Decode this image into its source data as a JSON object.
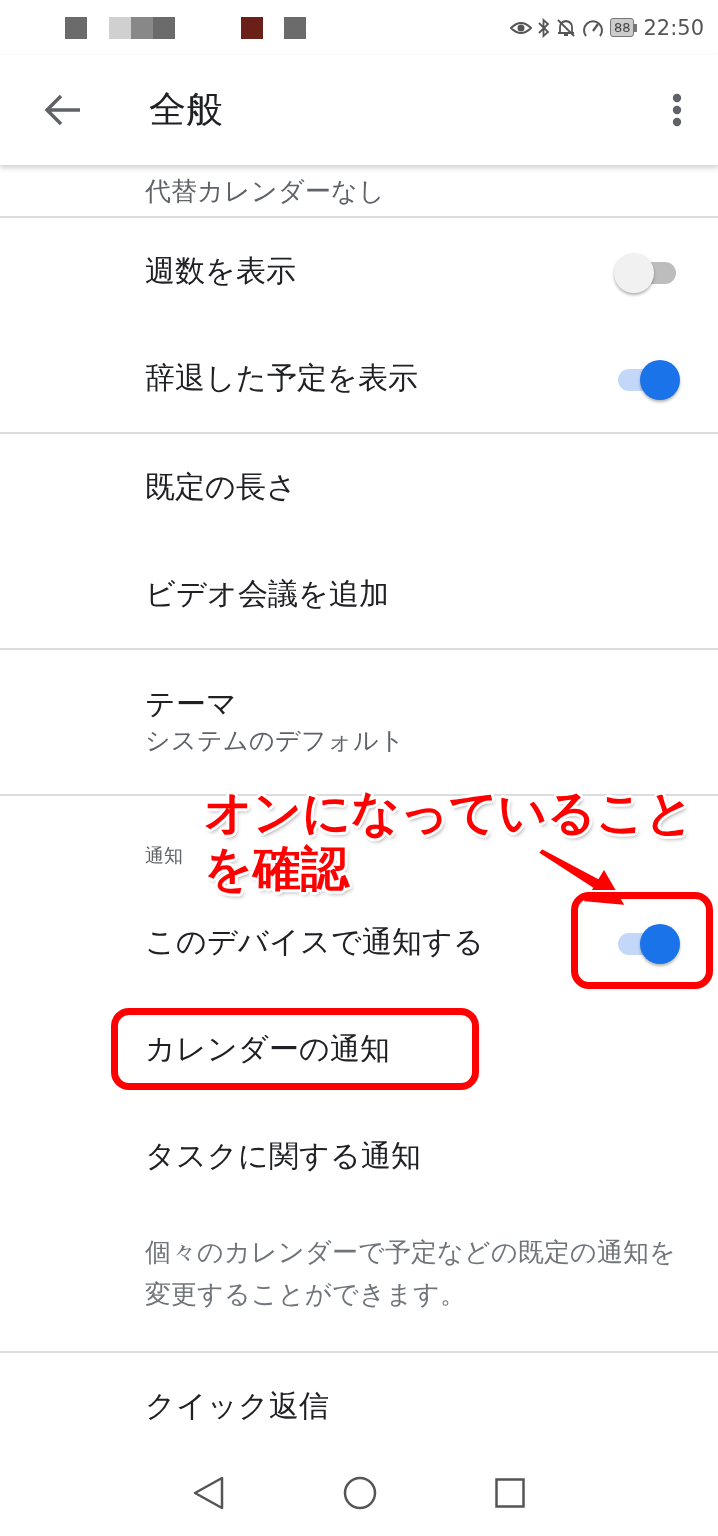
{
  "status_bar": {
    "battery": "88",
    "time": "22:50"
  },
  "app_bar": {
    "title": "全般"
  },
  "sections": [
    {
      "items": [
        {
          "kind": "cut",
          "title": "代替カレンダーなし"
        }
      ]
    },
    {
      "items": [
        {
          "kind": "toggle",
          "title": "週数を表示",
          "on": false
        },
        {
          "kind": "toggle",
          "title": "辞退した予定を表示",
          "on": true
        }
      ]
    },
    {
      "items": [
        {
          "kind": "plain",
          "title": "既定の長さ"
        },
        {
          "kind": "plain",
          "title": "ビデオ会議を追加"
        }
      ]
    },
    {
      "items": [
        {
          "kind": "twoline",
          "title": "テーマ",
          "subtitle": "システムのデフォルト"
        }
      ]
    },
    {
      "header": "通知",
      "items": [
        {
          "kind": "toggle",
          "title": "このデバイスで通知する",
          "on": true
        },
        {
          "kind": "plain",
          "title": "カレンダーの通知"
        },
        {
          "kind": "plain",
          "title": "タスクに関する通知"
        },
        {
          "kind": "note",
          "title": "個々のカレンダーで予定などの既定の通知を変更することができます。"
        }
      ]
    },
    {
      "items": [
        {
          "kind": "plain",
          "title": "クイック返信"
        }
      ]
    }
  ],
  "annotation": {
    "lines": [
      "オンになっていること",
      "を確認"
    ]
  }
}
